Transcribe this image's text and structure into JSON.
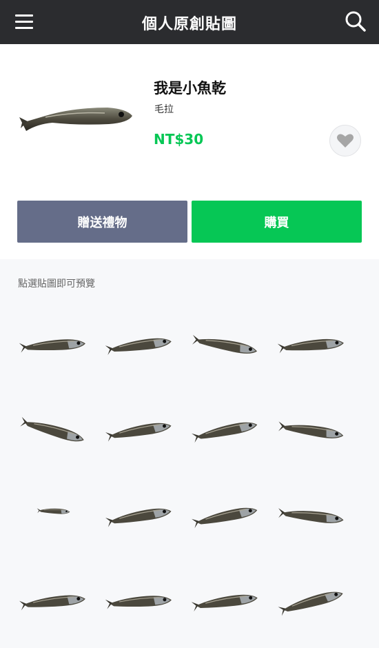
{
  "header": {
    "title": "個人原創貼圖",
    "menu_icon": "hamburger-menu-icon",
    "search_icon": "search-icon"
  },
  "product": {
    "title": "我是小魚乾",
    "author": "毛拉",
    "price": "NT$30",
    "favorite_icon": "heart-icon"
  },
  "actions": {
    "gift_label": "贈送禮物",
    "buy_label": "購買"
  },
  "stickers": {
    "hint": "點選貼圖即可預覽",
    "count": 16
  },
  "colors": {
    "header_bg": "#2b2c2f",
    "accent_green": "#06c755",
    "gift_button": "#656d89"
  }
}
